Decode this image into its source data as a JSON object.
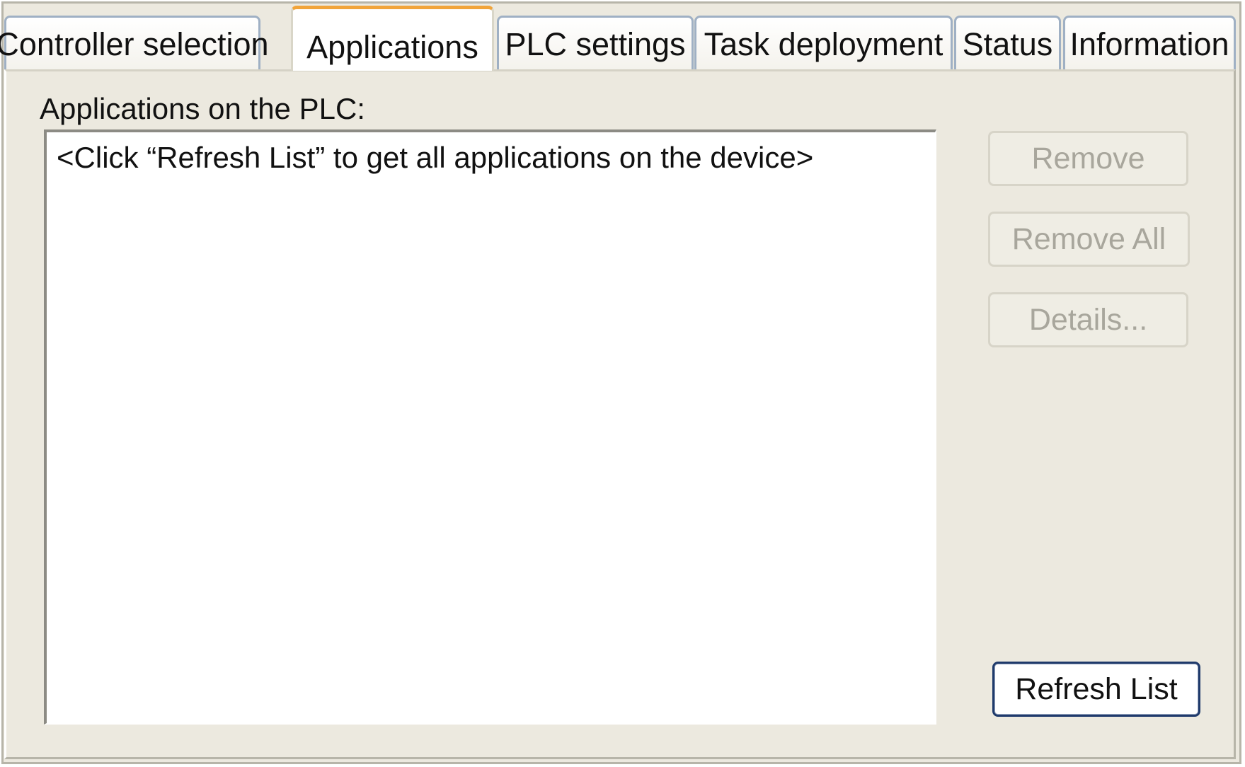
{
  "tabs": [
    {
      "label": "Controller selection"
    },
    {
      "label": "Applications"
    },
    {
      "label": "PLC settings"
    },
    {
      "label": "Task deployment"
    },
    {
      "label": "Status"
    },
    {
      "label": "Information"
    }
  ],
  "active_tab": "Applications",
  "main": {
    "list_label": "Applications on the PLC:",
    "list_placeholder": "<Click “Refresh List” to get all applications on the device>"
  },
  "buttons": {
    "remove": "Remove",
    "remove_all": "Remove All",
    "details": "Details...",
    "refresh": "Refresh List"
  },
  "colors": {
    "active_tab_accent": "#f1a43a",
    "panel_background": "#ece9df",
    "primary_button_border": "#1f3a6b"
  }
}
